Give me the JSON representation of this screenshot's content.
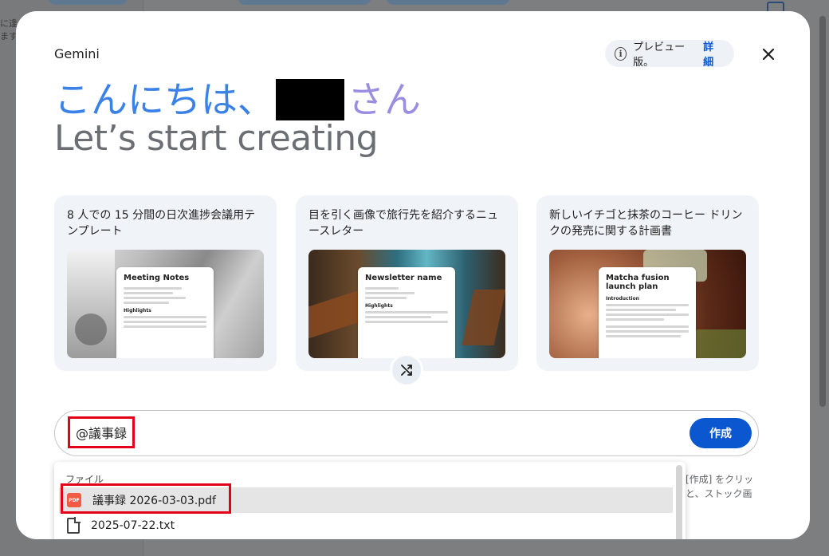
{
  "app": {
    "brand": "Gemini"
  },
  "preview": {
    "label": "プレビュー版。",
    "link": "詳細"
  },
  "hero": {
    "greeting": "こんにちは、",
    "suffix": "さん",
    "tagline": "Let’s start creating"
  },
  "cards": [
    {
      "text": "8 人での 15 分間の日次進捗会議用テンプレート",
      "doc_title": "Meeting Notes",
      "doc_section": "Highlights"
    },
    {
      "text": "目を引く画像で旅行先を紹介するニュースレター",
      "doc_title": "Newsletter name",
      "doc_section": "Highlights"
    },
    {
      "text": "新しいイチゴと抹茶のコーヒー ドリンクの発売に関する計画書",
      "doc_title": "Matcha fusion launch plan",
      "doc_section": "Introduction"
    }
  ],
  "prompt": {
    "value": "@議事録",
    "submit_label": "作成"
  },
  "side_hint": "[作成] をクリッ\nと、ストック画",
  "dropdown": {
    "header": "ファイル",
    "items": [
      {
        "label": "議事録 2026-03-03.pdf",
        "icon": "pdf-icon",
        "selected": true
      },
      {
        "label": "2025-07-22.txt",
        "icon": "file-icon",
        "selected": false
      }
    ]
  },
  "colors": {
    "accent": "#0b57d0",
    "greeting_blue": "#3b82e8",
    "greeting_purple": "#9b8de2",
    "highlight_red": "#e3001b"
  }
}
